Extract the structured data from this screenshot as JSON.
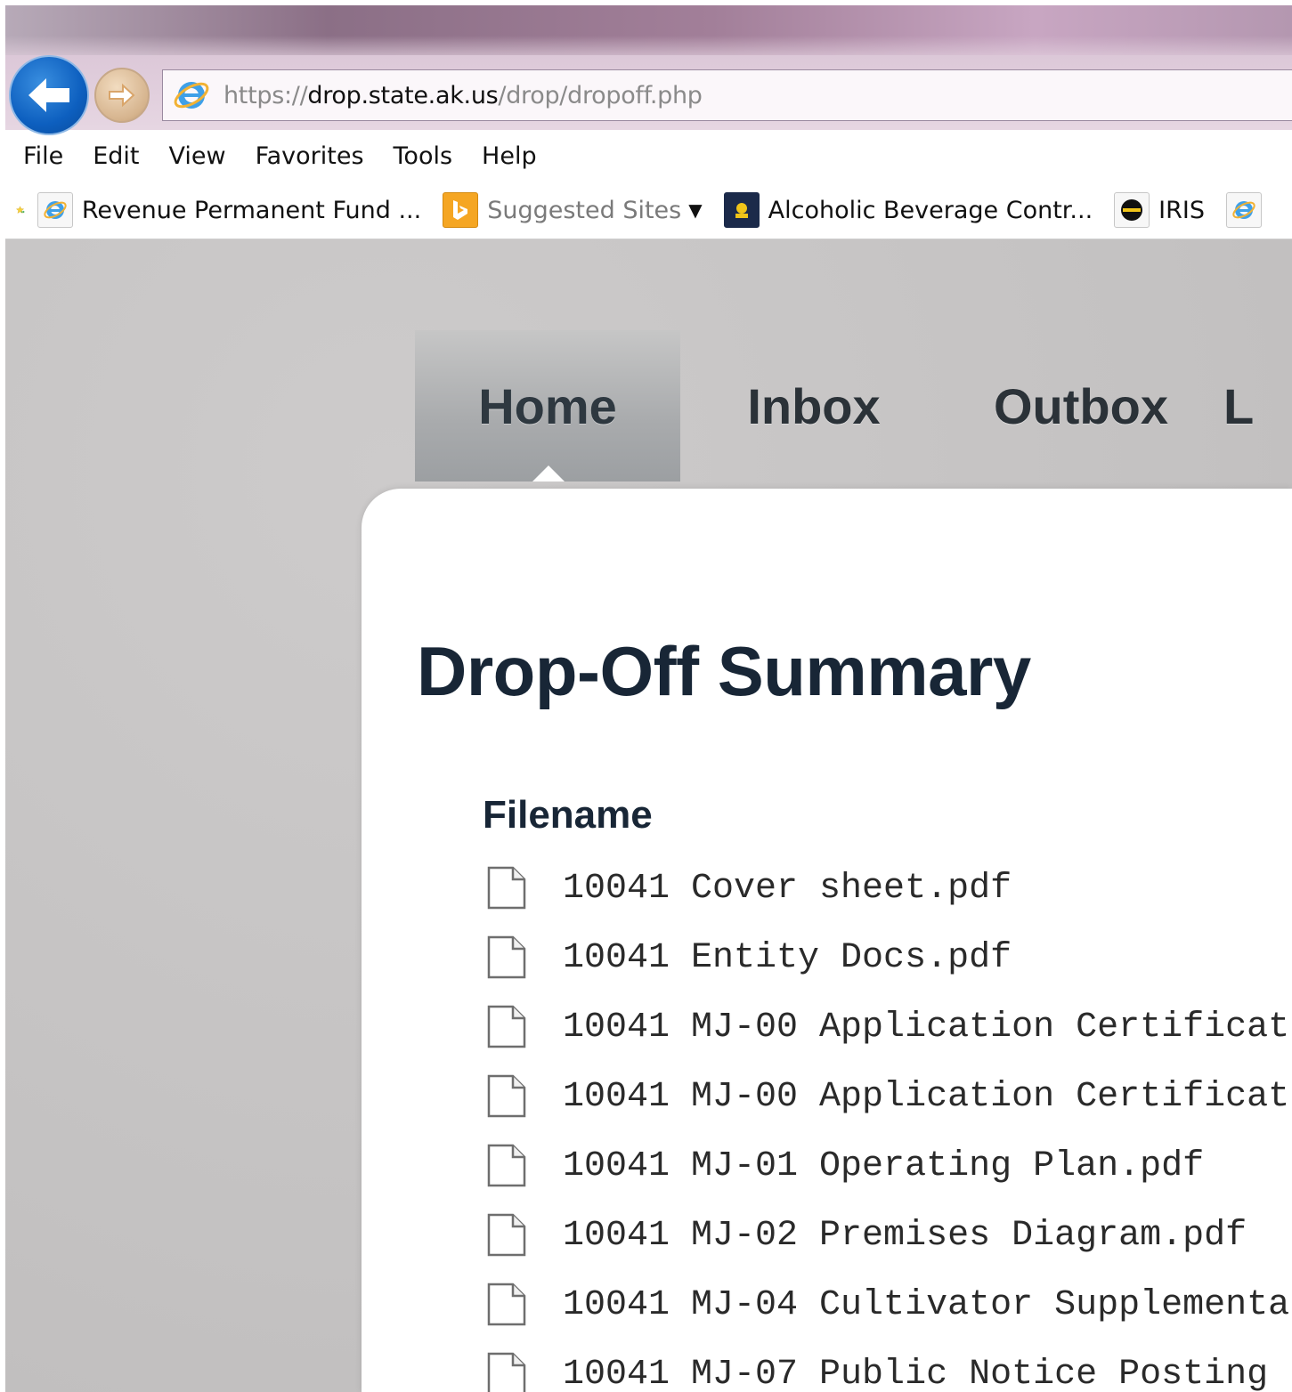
{
  "browser": {
    "url_scheme": "https://",
    "url_domain": "drop.state.ak.us",
    "url_path": "/drop/dropoff.php",
    "menu": [
      "File",
      "Edit",
      "View",
      "Favorites",
      "Tools",
      "Help"
    ],
    "favorites": {
      "item1": "Revenue Permanent Fund ...",
      "item2": "Suggested Sites",
      "item3": "Alcoholic Beverage Contr...",
      "item4": "IRIS"
    }
  },
  "nav": {
    "tabs": [
      "Home",
      "Inbox",
      "Outbox",
      "L"
    ],
    "active_tab": "Home"
  },
  "page": {
    "title": "Drop-Off Summary",
    "column_header": "Filename",
    "files": [
      "10041 Cover sheet.pdf",
      "10041 Entity Docs.pdf",
      "10041 MJ-00 Application Certificat",
      "10041 MJ-00 Application Certificat",
      "10041 MJ-01 Operating Plan.pdf",
      "10041 MJ-02 Premises Diagram.pdf",
      "10041 MJ-04 Cultivator Supplementa",
      "10041 MJ-07 Public Notice Posting"
    ]
  },
  "colors": {
    "heading": "#182636",
    "tab_text": "#2b3238",
    "page_bg": "#c4c2c2",
    "back_button": "#0d5fbf"
  },
  "icons": {
    "back": "back-arrow-icon",
    "forward": "forward-arrow-icon",
    "site": "ie-logo-icon",
    "favorites_star": "favorites-star-icon",
    "file": "document-icon"
  }
}
